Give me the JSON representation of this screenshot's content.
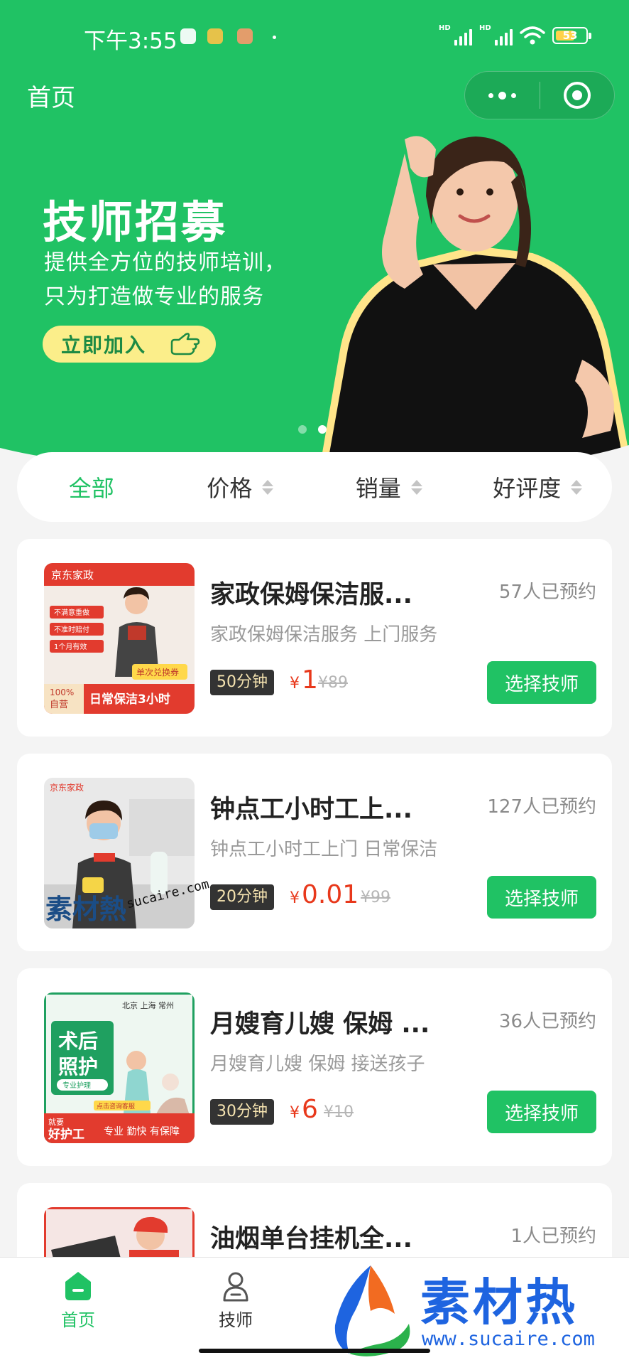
{
  "status_bar": {
    "time": "下午3:55",
    "signal1_label": "HD",
    "signal2_label": "HD",
    "battery": "53"
  },
  "nav": {
    "title": "首页",
    "more_icon": "more-dots-icon",
    "close_icon": "target-circle-icon"
  },
  "banner": {
    "title": "技师招募",
    "subtitle_line1": "提供全方位的技师培训，",
    "subtitle_line2": "只为打造做专业的服务",
    "cta_label": "立即加入",
    "cta_icon": "pointing-hand-icon",
    "slide_count": 2,
    "active_slide": 2
  },
  "sort": {
    "items": [
      {
        "label": "全部",
        "active": true
      },
      {
        "label": "价格",
        "active": false
      },
      {
        "label": "销量",
        "active": false
      },
      {
        "label": "好评度",
        "active": false
      }
    ]
  },
  "services": [
    {
      "title": "家政保姆保洁服...",
      "booked": "57人已预约",
      "desc": "家政保姆保洁服务 上门服务",
      "duration": "50分钟",
      "currency": "¥",
      "price": "1",
      "orig_price": "¥89",
      "button": "选择技师",
      "thumb_text": {
        "brand": "京东家政",
        "tag1": "不满意重做",
        "tag2": "不准时赔付",
        "tag3": "1个月有效",
        "coupon": "单次兑换券",
        "badge_line1": "100%",
        "badge_line2": "自营",
        "footer": "日常保洁3小时"
      }
    },
    {
      "title": "钟点工小时工上...",
      "booked": "127人已预约",
      "desc": "钟点工小时工上门 日常保洁",
      "duration": "20分钟",
      "currency": "¥",
      "price": "0.01",
      "orig_price": "¥99",
      "button": "选择技师",
      "thumb_text": {
        "brand": "京东家政"
      }
    },
    {
      "title": "月嫂育儿嫂 保姆 ...",
      "booked": "36人已预约",
      "desc": "月嫂育儿嫂 保姆 接送孩子",
      "duration": "30分钟",
      "currency": "¥",
      "price": "6",
      "orig_price": "¥10",
      "button": "选择技师",
      "thumb_text": {
        "cities": "北京 上海 常州",
        "headline1": "术后",
        "headline2": "照护",
        "sub": "专业护理",
        "consult": "点击咨询客服",
        "footer_a1": "就要",
        "footer_a2": "好护工",
        "footer_b": "专业 勤快 有保障"
      }
    },
    {
      "title": "油烟单台挂机全...",
      "booked": "1人已预约"
    }
  ],
  "tabbar": {
    "tabs": [
      {
        "label": "首页",
        "icon": "home-icon",
        "active": true
      },
      {
        "label": "技师",
        "icon": "technician-icon",
        "active": false
      }
    ]
  },
  "watermark": {
    "logo_text": "素材热",
    "url": "www.sucaire.com",
    "inline_logo": "素材熱",
    "inline_url": "sucaire.com"
  },
  "colors": {
    "brand_green": "#20c264",
    "price_red": "#e8381b",
    "cta_yellow": "#fbee8a"
  }
}
